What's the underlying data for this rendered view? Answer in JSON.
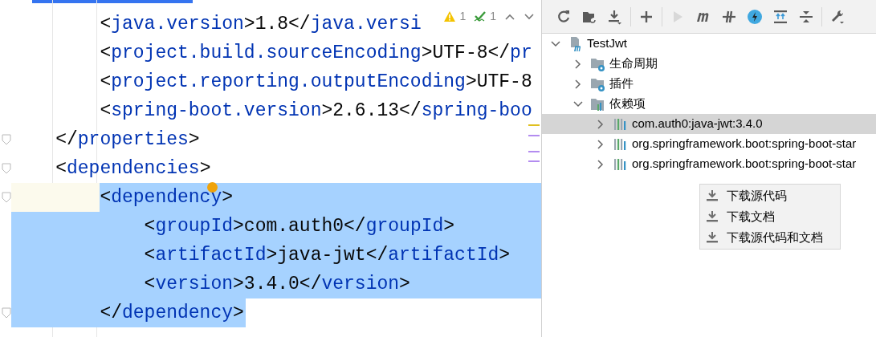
{
  "editor": {
    "inspections": {
      "warnings": "1",
      "checks": "1"
    },
    "lines": [
      {
        "children": [
          {
            "tokens": [
              {
                "kind": "punct",
                "text": "<"
              },
              {
                "kind": "tag",
                "text": "java.version"
              },
              {
                "kind": "punct",
                "text": ">1.8</"
              },
              {
                "kind": "tag",
                "text": "java.versi"
              }
            ],
            "selected": false
          },
          {
            "tokens": [
              {
                "kind": "punct",
                "text": "<"
              },
              {
                "kind": "tag",
                "text": "project.build.sourceEncoding"
              },
              {
                "kind": "punct",
                "text": ">UTF-8</"
              },
              {
                "kind": "tag",
                "text": "pr"
              }
            ],
            "selected": false
          },
          {
            "tokens": [
              {
                "kind": "punct",
                "text": "<"
              },
              {
                "kind": "tag",
                "text": "project.reporting.outputEncoding"
              },
              {
                "kind": "punct",
                "text": ">UTF-8"
              }
            ],
            "selected": false
          },
          {
            "tokens": [
              {
                "kind": "punct",
                "text": "<"
              },
              {
                "kind": "tag",
                "text": "spring-boot.version"
              },
              {
                "kind": "punct",
                "text": ">2.6.13</"
              },
              {
                "kind": "tag",
                "text": "spring-boo"
              }
            ],
            "selected": false
          }
        ]
      },
      {
        "tokens": [
          {
            "kind": "punct",
            "text": "</"
          },
          {
            "kind": "tag",
            "text": "properties"
          },
          {
            "kind": "punct",
            "text": ">"
          }
        ],
        "selected": false,
        "fold": true
      },
      {
        "tokens": [
          {
            "kind": "punct",
            "text": "<"
          },
          {
            "kind": "tag",
            "text": "dependencies"
          },
          {
            "kind": "punct",
            "text": ">"
          }
        ],
        "selected": false,
        "fold": true,
        "children": [
          {
            "tokens": [
              {
                "kind": "punct",
                "text": "<"
              },
              {
                "kind": "tag",
                "text": "dependency"
              },
              {
                "kind": "punct",
                "text": ">"
              }
            ],
            "selected": true,
            "current": true,
            "bulb": true,
            "fold": true,
            "children": [
              {
                "tokens": [
                  {
                    "kind": "punct",
                    "text": "<"
                  },
                  {
                    "kind": "tag",
                    "text": "groupId"
                  },
                  {
                    "kind": "punct",
                    "text": ">com.auth0</"
                  },
                  {
                    "kind": "tag",
                    "text": "groupId"
                  },
                  {
                    "kind": "punct",
                    "text": ">"
                  }
                ],
                "selected": true
              },
              {
                "tokens": [
                  {
                    "kind": "punct",
                    "text": "<"
                  },
                  {
                    "kind": "tag",
                    "text": "artifactId"
                  },
                  {
                    "kind": "punct",
                    "text": ">java-jwt</"
                  },
                  {
                    "kind": "tag",
                    "text": "artifactId"
                  },
                  {
                    "kind": "punct",
                    "text": ">"
                  }
                ],
                "selected": true
              },
              {
                "tokens": [
                  {
                    "kind": "punct",
                    "text": "<"
                  },
                  {
                    "kind": "tag",
                    "text": "version"
                  },
                  {
                    "kind": "punct",
                    "text": ">3.4.0</"
                  },
                  {
                    "kind": "tag",
                    "text": "version"
                  },
                  {
                    "kind": "punct",
                    "text": ">"
                  }
                ],
                "selected": true
              }
            ]
          },
          {
            "tokens": [
              {
                "kind": "punct",
                "text": "</"
              },
              {
                "kind": "tag",
                "text": "dependency"
              },
              {
                "kind": "punct",
                "text": ">"
              }
            ],
            "selected": true,
            "fold": true
          }
        ]
      }
    ]
  },
  "maven": {
    "toolbar": [
      [
        {
          "kind": "refresh",
          "disabled": false
        },
        {
          "kind": "folder-refresh",
          "disabled": false
        },
        {
          "kind": "download",
          "disabled": false
        }
      ],
      [
        {
          "kind": "plus",
          "disabled": false
        }
      ],
      [
        {
          "kind": "run",
          "disabled": true
        },
        {
          "kind": "m",
          "disabled": false
        },
        {
          "kind": "skip",
          "disabled": false
        },
        {
          "kind": "bolt",
          "disabled": false
        },
        {
          "kind": "expand",
          "disabled": false
        },
        {
          "kind": "collapse",
          "disabled": false
        }
      ],
      [
        {
          "kind": "wrench",
          "disabled": false
        }
      ]
    ],
    "tree": [
      {
        "label": "TestJwt",
        "kind": "module",
        "expanded": true,
        "selected": false,
        "children": [
          {
            "label": "生命周期",
            "kind": "lifecycle",
            "expanded": false,
            "selected": false
          },
          {
            "label": "插件",
            "kind": "plugins",
            "expanded": false,
            "selected": false
          },
          {
            "label": "依赖项",
            "kind": "dependencies",
            "expanded": true,
            "selected": false,
            "children": [
              {
                "label": "com.auth0:java-jwt:3.4.0",
                "kind": "library",
                "expanded": false,
                "selected": true
              },
              {
                "label": "org.springframework.boot:spring-boot-star",
                "kind": "library",
                "expanded": false,
                "selected": false
              },
              {
                "label": "org.springframework.boot:spring-boot-star",
                "kind": "library",
                "expanded": false,
                "selected": false
              }
            ]
          }
        ]
      }
    ],
    "menu": [
      {
        "label": "下载源代码"
      },
      {
        "label": "下载文档"
      },
      {
        "label": "下载源代码和文档"
      }
    ]
  }
}
